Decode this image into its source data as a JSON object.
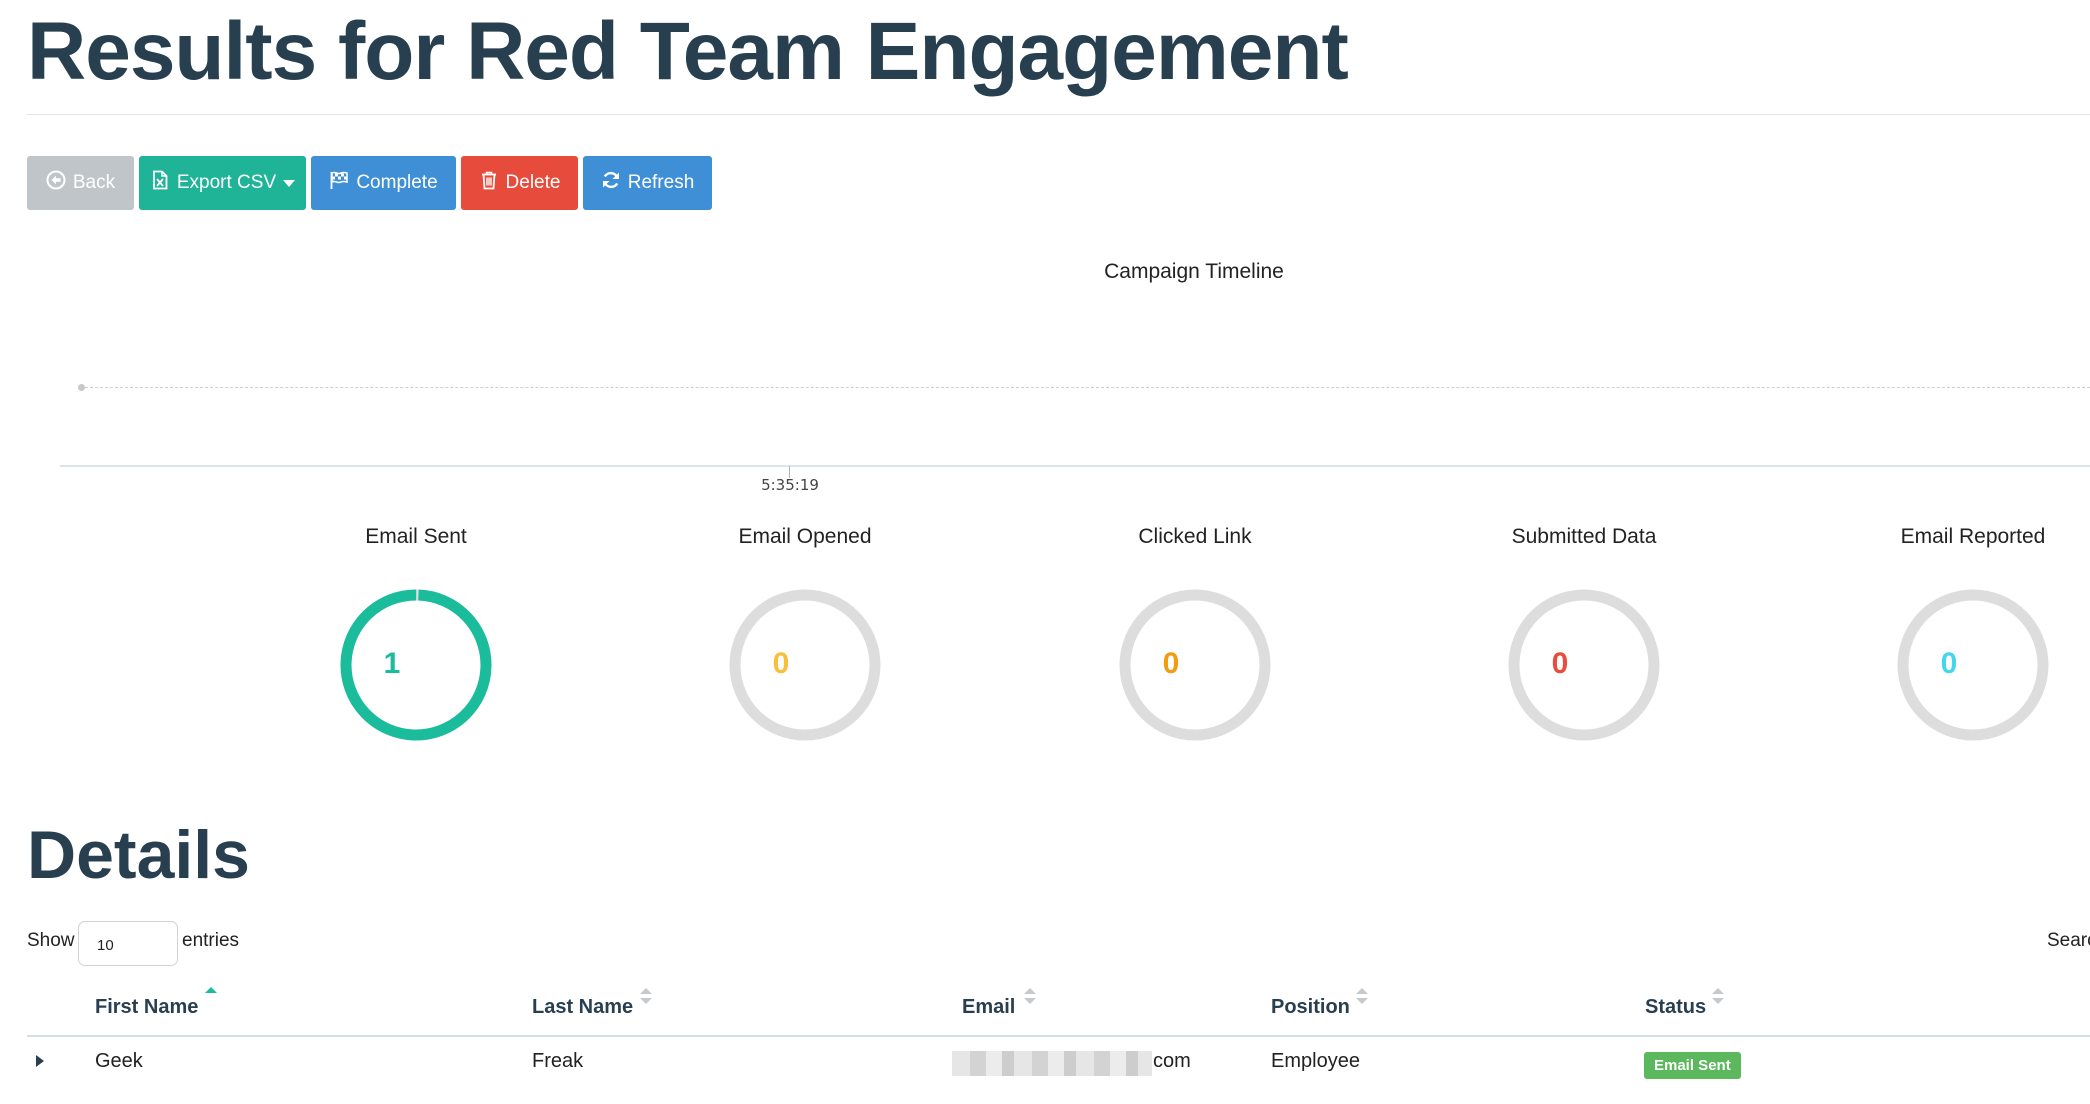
{
  "page": {
    "title": "Results for Red Team Engagement"
  },
  "toolbar": {
    "back_label": "Back",
    "export_label": "Export CSV",
    "complete_label": "Complete",
    "delete_label": "Delete",
    "refresh_label": "Refresh"
  },
  "timeline": {
    "title": "Campaign Timeline",
    "tick_label": "5:35:19"
  },
  "stats": [
    {
      "label": "Email Sent",
      "value": "1",
      "fraction": 1.0,
      "color": "#1abc9c"
    },
    {
      "label": "Email Opened",
      "value": "0",
      "fraction": 0.0,
      "color": "#f9bf3b"
    },
    {
      "label": "Clicked Link",
      "value": "0",
      "fraction": 0.0,
      "color": "#f39c12"
    },
    {
      "label": "Submitted Data",
      "value": "0",
      "fraction": 0.0,
      "color": "#e74c3c"
    },
    {
      "label": "Email Reported",
      "value": "0",
      "fraction": 0.0,
      "color": "#45d6ef"
    }
  ],
  "details": {
    "title": "Details",
    "show_label": "Show",
    "entries_value": "10",
    "entries_label": "entries",
    "search_label": "Search:",
    "columns": [
      "First Name",
      "Last Name",
      "Email",
      "Position",
      "Status"
    ],
    "rows": [
      {
        "first_name": "Geek",
        "last_name": "Freak",
        "email_suffix": "com",
        "position": "Employee",
        "status": "Email Sent"
      }
    ]
  },
  "colors": {
    "heading": "#283f50",
    "ring_track": "#dddddd",
    "status_sent": "#5cb85c"
  }
}
